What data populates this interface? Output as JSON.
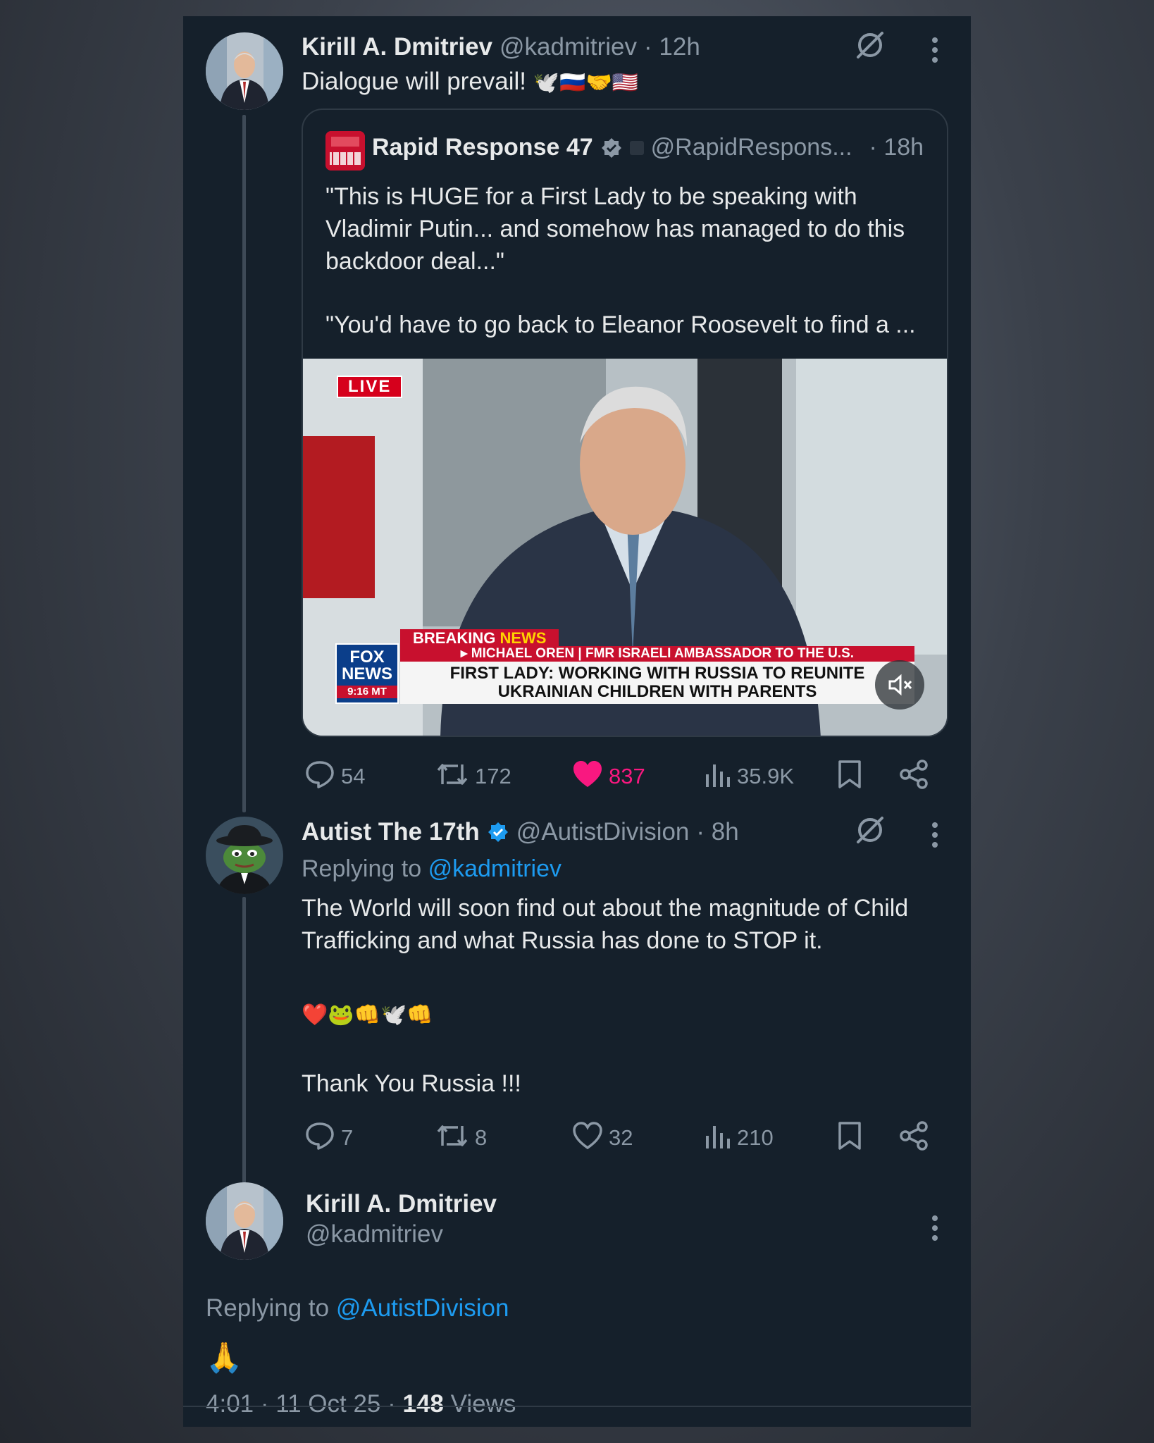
{
  "tweet1": {
    "name": "Kirill A. Dmitriev",
    "handle": "@kadmitriev",
    "time": "· 12h",
    "text": "Dialogue will prevail!",
    "emojis": "🕊️🇷🇺🤝🇺🇸",
    "quote": {
      "name": "Rapid Response 47",
      "handle": "@RapidRespons...",
      "time": "· 18h",
      "text1": "\"This is HUGE for a First Lady to be speaking with Vladimir Putin... and somehow has managed to do this backdoor deal...\"",
      "text2": "\"You'd have to go back to Eleanor Roosevelt to find a ...",
      "video": {
        "live": "LIVE",
        "breaking": "BREAKING NEWS",
        "breaking_a": "BREAKING",
        "breaking_b": "NEWS",
        "subline": "▸ MICHAEL OREN | FMR ISRAELI AMBASSADOR TO THE U.S.",
        "headline1": "FIRST LADY: WORKING WITH RUSSIA TO REUNITE",
        "headline2": "UKRAINIAN CHILDREN WITH PARENTS",
        "logo1": "FOX",
        "logo2": "NEWS",
        "clock": "9:16 MT"
      }
    },
    "stats": {
      "replies": "54",
      "reposts": "172",
      "likes": "837",
      "views": "35.9K"
    }
  },
  "tweet2": {
    "name": "Autist The 17th",
    "handle": "@AutistDivision",
    "time": "· 8h",
    "replying_prefix": "Replying to",
    "replying_to": "@kadmitriev",
    "text1": "The World will soon find out about the magnitude of Child Trafficking and what Russia has done to STOP it.",
    "emojis": "❤️🐸👊🕊️👊",
    "text2": "Thank You Russia !!!",
    "stats": {
      "replies": "7",
      "reposts": "8",
      "likes": "32",
      "views": "210"
    }
  },
  "tweet3": {
    "name": "Kirill A. Dmitriev",
    "handle": "@kadmitriev",
    "replying_prefix": "Replying to",
    "replying_to": "@AutistDivision",
    "text": "🙏",
    "time": "4:01 · 11 Oct 25 ·",
    "views_count": "148",
    "views_label": "Views"
  },
  "colors": {
    "accent": "#1d9bf0",
    "like": "#f91880",
    "background": "#15202b",
    "muted": "#8b98a5"
  }
}
